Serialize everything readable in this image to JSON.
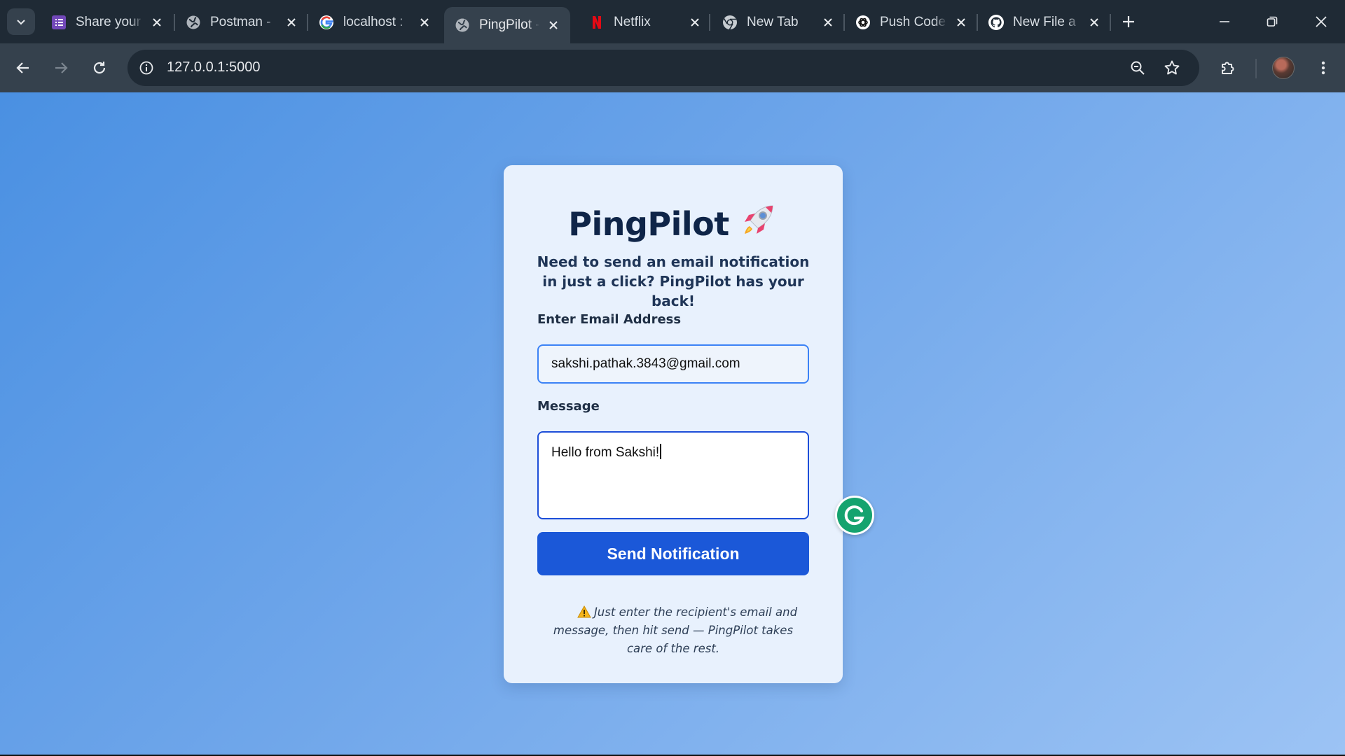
{
  "browser": {
    "tabs": [
      {
        "title": "Share your",
        "icon": "forms-icon"
      },
      {
        "title": "Postman -",
        "icon": "globe-icon"
      },
      {
        "title": "localhost :",
        "icon": "google-icon"
      },
      {
        "title": "PingPilot -",
        "icon": "globe-icon",
        "active": true
      },
      {
        "title": "Netflix",
        "icon": "netflix-icon"
      },
      {
        "title": "New Tab",
        "icon": "chrome-icon"
      },
      {
        "title": "Push Code",
        "icon": "openai-icon"
      },
      {
        "title": "New File a",
        "icon": "github-icon"
      }
    ],
    "url": "127.0.0.1:5000"
  },
  "app": {
    "title": "PingPilot",
    "subtitle": "Need to send an email notification in just a click? PingPilot has your back!",
    "email_label": "Enter Email Address",
    "email_value": "sakshi.pathak.3843@gmail.com",
    "message_label": "Message",
    "message_value": "Hello from Sakshi!",
    "send_label": "Send Notification",
    "note": "Just enter the recipient's email and message, then hit send — PingPilot takes care of the rest."
  },
  "colors": {
    "accent": "#1b58d8",
    "title": "#0f2548",
    "card_bg": "#e8f1fd",
    "grammarly": "#15a36f"
  }
}
